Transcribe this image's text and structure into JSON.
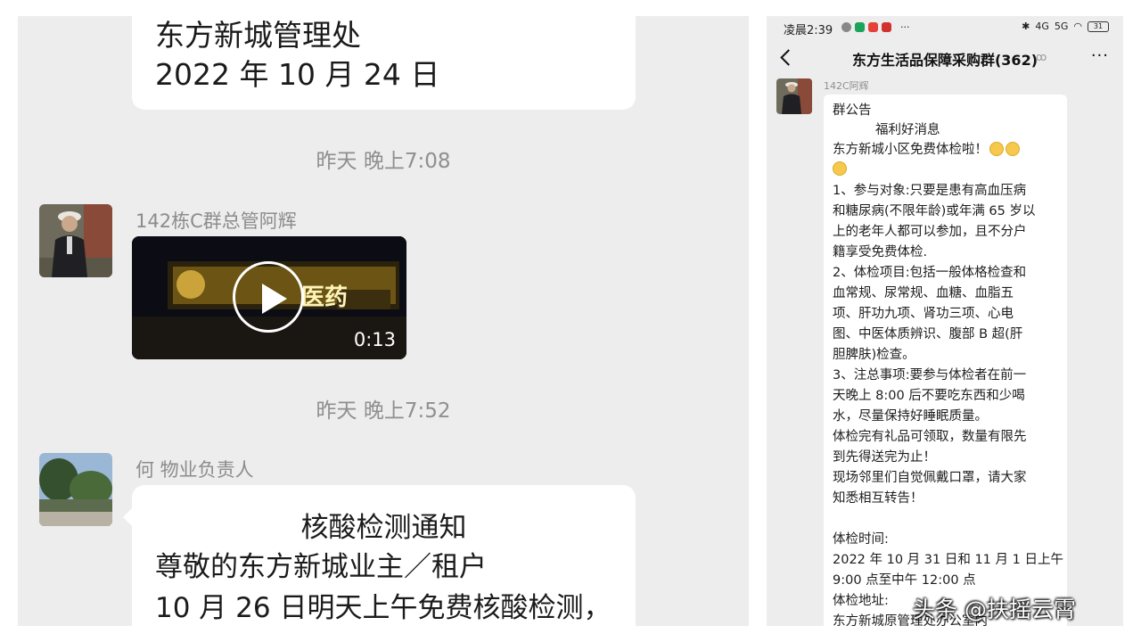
{
  "left_chat": {
    "top_message": {
      "line1": "东方新城管理处",
      "line2": "2022 年 10 月 24 日"
    },
    "time_1": "昨天 晚上7:08",
    "sender_1": "142栋C群总管阿辉",
    "video": {
      "duration": "0:13",
      "sign_text": "医药"
    },
    "time_2": "昨天 晚上7:52",
    "sender_2": "何 物业负责人",
    "notice": {
      "title": "核酸检测通知",
      "line1": "尊敬的东方新城业主／租户",
      "line2": "10 月 26 日明天上午免费核酸检测，"
    }
  },
  "right_chat": {
    "status": {
      "time": "凌晨2:39",
      "battery": "31",
      "network": "4G",
      "signal": "5G",
      "more_dots": "···"
    },
    "group_title": "东方生活品保障采购群(362)",
    "more_label": "···",
    "sender": "142C阿辉",
    "bubble_lines": [
      "群公告",
      "福利好消息",
      "东方新城小区免费体检啦！",
      "",
      "1、参与对象:只要是患有高血压病",
      "和糖尿病(不限年龄)或年满 65 岁以",
      "上的老年人都可以参加，且不分户",
      "籍享受免费体检.",
      "2、体检项目:包括一般体格检查和",
      "血常规、尿常规、血糖、血脂五",
      "项、肝功九项、肾功三项、心电",
      "图、中医体质辨识、腹部 B 超(肝",
      "胆脾肤)检查。",
      "3、注总事项:要参与体检者在前一",
      "天晚上 8:00 后不要吃东西和少喝",
      "水，尽量保持好睡眠质量。",
      "体检完有礼品可领取，数量有限先",
      "到先得送完为止！",
      "现场邻里们自觉佩戴口罩，请大家",
      "知悉相互转告！",
      "",
      "体检时间:",
      "2022 年 10 月 31 日和 11 月 1 日上午",
      "9:00 点至中午 12:00 点",
      "体检地址:",
      "东方新城原管理处办公室内"
    ]
  },
  "watermark": "头条 @扶摇云霄",
  "colors": {
    "chat_bg": "#ededed",
    "bubble": "#ffffff",
    "meta_text": "#8f8f8f"
  }
}
